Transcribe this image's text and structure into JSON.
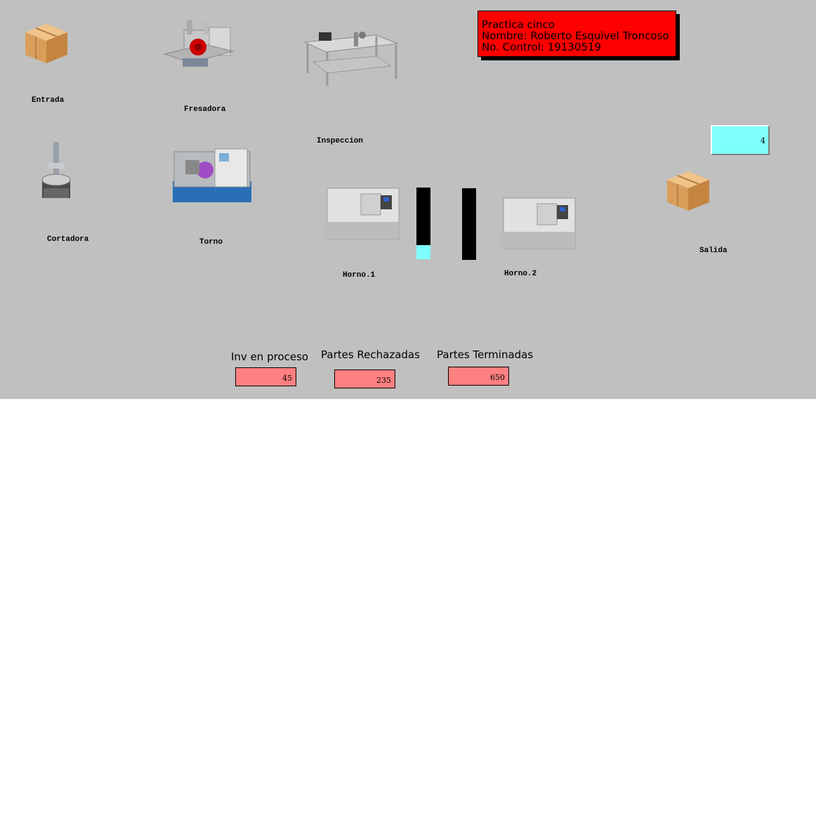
{
  "header": {
    "line1": "Practica cinco",
    "line2": "Nombre: Roberto Esquivel Troncoso",
    "line3": "No. Control: 19130519"
  },
  "stations": {
    "entrada": "Entrada",
    "fresadora": "Fresadora",
    "inspeccion": "Inspeccion",
    "cortadora": "Cortadora",
    "torno": "Torno",
    "horno1": "Horno.1",
    "horno2": "Horno.2",
    "salida": "Salida"
  },
  "salida_counter": "4",
  "queues": {
    "queue1_fill_fraction": 0.2,
    "queue2_fill_fraction": 0.0,
    "fill_color": "#80ffff"
  },
  "stats": {
    "inv_label": "Inv en proceso",
    "inv_value": "45",
    "rech_label": "Partes Rechazadas",
    "rech_value": "235",
    "term_label": "Partes Terminadas",
    "term_value": "650"
  },
  "colors": {
    "background": "#c0c0c0",
    "title_box": "#ff0000",
    "value_box": "#ff8080",
    "counter_box": "#80ffff"
  }
}
